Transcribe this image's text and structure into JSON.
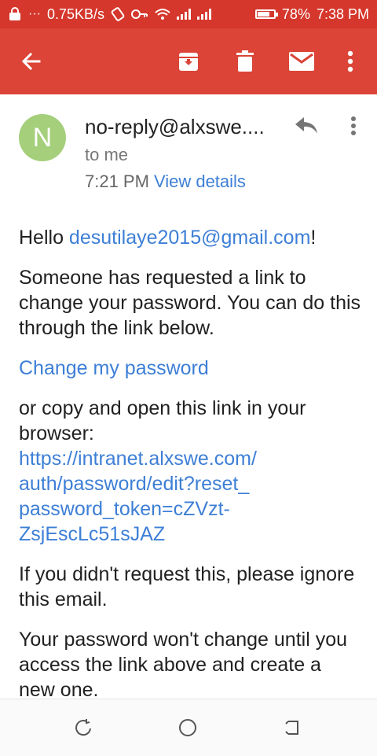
{
  "status_bar": {
    "net_speed": "0.75KB/s",
    "battery_percent": "78%",
    "battery_level": 0.78,
    "time": "7:38 PM"
  },
  "app_bar": {
    "icons": [
      "back-arrow-icon",
      "archive-icon",
      "trash-icon",
      "mail-icon",
      "more-vert-icon"
    ],
    "color": "#db4437",
    "status_color": "#d5372c"
  },
  "email_header": {
    "avatar_initial": "N",
    "avatar_color": "#a5cf7b",
    "sender": "no-reply@alxswe....",
    "recipient": "to me",
    "time": "7:21 PM",
    "view_details": "View details"
  },
  "email_body": {
    "greeting_prefix": "Hello ",
    "greeting_email": "desutilaye2015@gmail.com",
    "greeting_suffix": "!",
    "paragraph1": "Someone has requested a link to change your password. You can do this through the link below.",
    "change_link": "Change my password",
    "copy_text": "or copy and open this link in your browser:",
    "reset_url_lines": [
      "https://intranet.alxswe.com/",
      "auth/password/edit?reset_",
      "password_token=cZVzt-",
      "ZsjEscLc51sJAZ"
    ],
    "paragraph3": "If you didn't request this, please ignore this email.",
    "paragraph4": "Your password won't change until you access the link above and create a new one."
  },
  "nav_bar": {
    "icons": [
      "back-nav-icon",
      "home-nav-icon",
      "recents-nav-icon"
    ]
  },
  "link_color": "#3d7fd6"
}
